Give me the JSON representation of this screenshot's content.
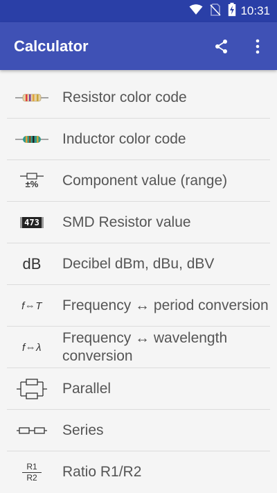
{
  "status_bar": {
    "time": "10:31",
    "icons": [
      "wifi-icon",
      "no-sim-icon",
      "battery-charging-icon"
    ]
  },
  "app_bar": {
    "title": "Calculator",
    "actions": [
      "share-icon",
      "more-vert-icon"
    ]
  },
  "list": {
    "items": [
      {
        "label": "Resistor color code",
        "icon": "resistor-icon"
      },
      {
        "label": "Inductor color code",
        "icon": "inductor-icon"
      },
      {
        "label": "Component value (range)",
        "icon": "component-range-icon",
        "icon_text": "±%"
      },
      {
        "label": "SMD Resistor value",
        "icon": "smd-resistor-icon",
        "icon_text": "473"
      },
      {
        "label": "Decibel dBm, dBu, dBV",
        "icon": "decibel-icon",
        "icon_text": "dB"
      },
      {
        "label": "Frequency ↔ period conversion",
        "icon": "freq-period-icon",
        "icon_text": "f⇔T"
      },
      {
        "label": "Frequency ↔ wavelength conversion",
        "icon": "freq-wavelength-icon",
        "icon_text": "f⇔λ"
      },
      {
        "label": "Parallel",
        "icon": "parallel-icon"
      },
      {
        "label": "Series",
        "icon": "series-icon"
      },
      {
        "label": "Ratio R1/R2",
        "icon": "ratio-icon",
        "icon_text_top": "R1",
        "icon_text_bottom": "R2"
      }
    ]
  },
  "colors": {
    "status_bar": "#2a3fa7",
    "app_bar": "#3f51b5",
    "background": "#f5f5f5",
    "text": "#555555"
  }
}
